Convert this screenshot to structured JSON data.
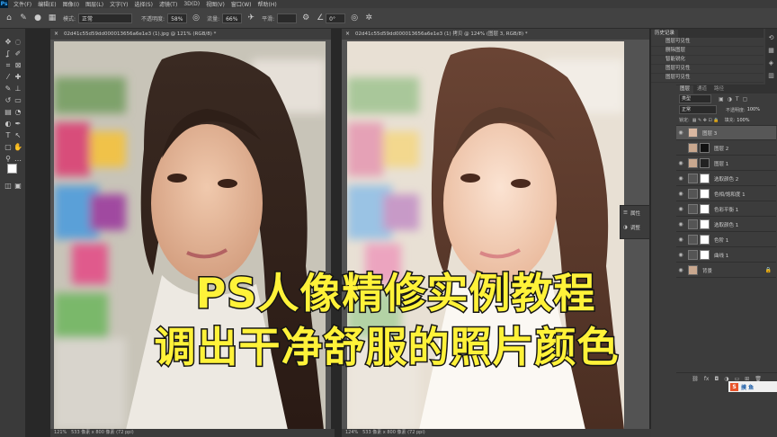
{
  "app": {
    "icon_text": "Ps",
    "menu": [
      "文件(F)",
      "编辑(E)",
      "图像(I)",
      "图层(L)",
      "文字(Y)",
      "选择(S)",
      "滤镜(T)",
      "3D(D)",
      "视图(V)",
      "窗口(W)",
      "帮助(H)"
    ]
  },
  "options": {
    "mode_label": "模式:",
    "mode_value": "正常",
    "opacity_label": "不透明度:",
    "opacity_value": "58%",
    "flow_label": "流量:",
    "flow_value": "66%",
    "smooth_label": "平滑:",
    "angle_value": "0°"
  },
  "documents": [
    {
      "tab": "02d41c55d59dd000013656a6e1e3 (1).jpg @ 121% (RGB/8) *",
      "zoom": "121%",
      "status": "533 像素 x 800 像素 (72 ppi)"
    },
    {
      "tab": "02d41c55d59dd000013656a6e1e3 (1) 拷贝 @ 124% (图层 3, RGB/8) *",
      "zoom": "124%",
      "status": "533 像素 x 800 像素 (72 ppi)"
    }
  ],
  "floating_panel": {
    "properties": "属性",
    "adjust": "调整"
  },
  "history": {
    "tab": "历史记录",
    "items": [
      "图层可见性",
      "删除图层",
      "智能锐化",
      "图层可见性",
      "图层可见性",
      "图层可见性"
    ]
  },
  "layers": {
    "tabs": [
      "图层",
      "通道",
      "路径"
    ],
    "kind_label": "类型",
    "blend": "正常",
    "opacity_label": "不透明度:",
    "opacity_value": "100%",
    "lock_label": "锁定:",
    "fill_label": "填充:",
    "fill_value": "100%",
    "items": [
      {
        "name": "图层 3",
        "selected": true
      },
      {
        "name": "图层 2"
      },
      {
        "name": "图层 1"
      },
      {
        "name": "选取颜色 2"
      },
      {
        "name": "色相/饱和度 1"
      },
      {
        "name": "色彩平衡 1"
      },
      {
        "name": "选取颜色 1"
      },
      {
        "name": "色阶 1"
      },
      {
        "name": "曲线 1"
      },
      {
        "name": "背景"
      }
    ]
  },
  "overlay": {
    "line1": "PS人像精修实例教程",
    "line2": "调出干净舒服的照片颜色"
  },
  "watermark": "摸 鱼",
  "colors": {
    "title_yellow": "#fff239",
    "ui_dark": "#282828",
    "panel": "#3c3c3c",
    "selected_layer": "#575757"
  }
}
